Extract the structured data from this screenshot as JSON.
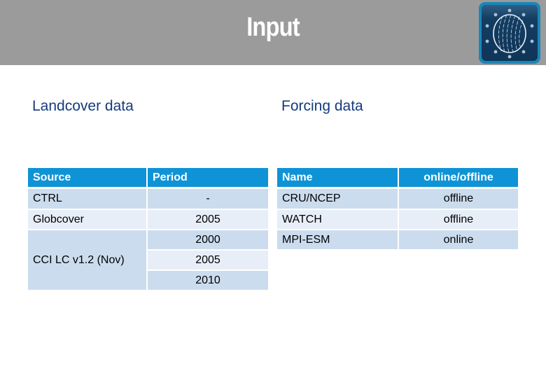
{
  "header": {
    "title": "Input",
    "logo_icon": "globe-logo-icon"
  },
  "landcover": {
    "heading": "Landcover data",
    "columns": [
      "Source",
      "Period"
    ],
    "rows": [
      {
        "source": "CTRL",
        "periods": [
          "-"
        ]
      },
      {
        "source": "Globcover",
        "periods": [
          "2005"
        ]
      },
      {
        "source": "CCI LC v1.2 (Nov)",
        "periods": [
          "2000",
          "2005",
          "2010"
        ]
      }
    ]
  },
  "forcing": {
    "heading": "Forcing data",
    "columns": [
      "Name",
      "online/offline"
    ],
    "rows": [
      {
        "name": "CRU/NCEP",
        "mode": "offline"
      },
      {
        "name": "WATCH",
        "mode": "offline"
      },
      {
        "name": "MPI-ESM",
        "mode": "online"
      }
    ]
  },
  "colors": {
    "header_bar": "#9b9b9b",
    "heading_text": "#163a7c",
    "table_header": "#0e93d6",
    "row_dark": "#cbdcee",
    "row_light": "#e7eef7"
  }
}
